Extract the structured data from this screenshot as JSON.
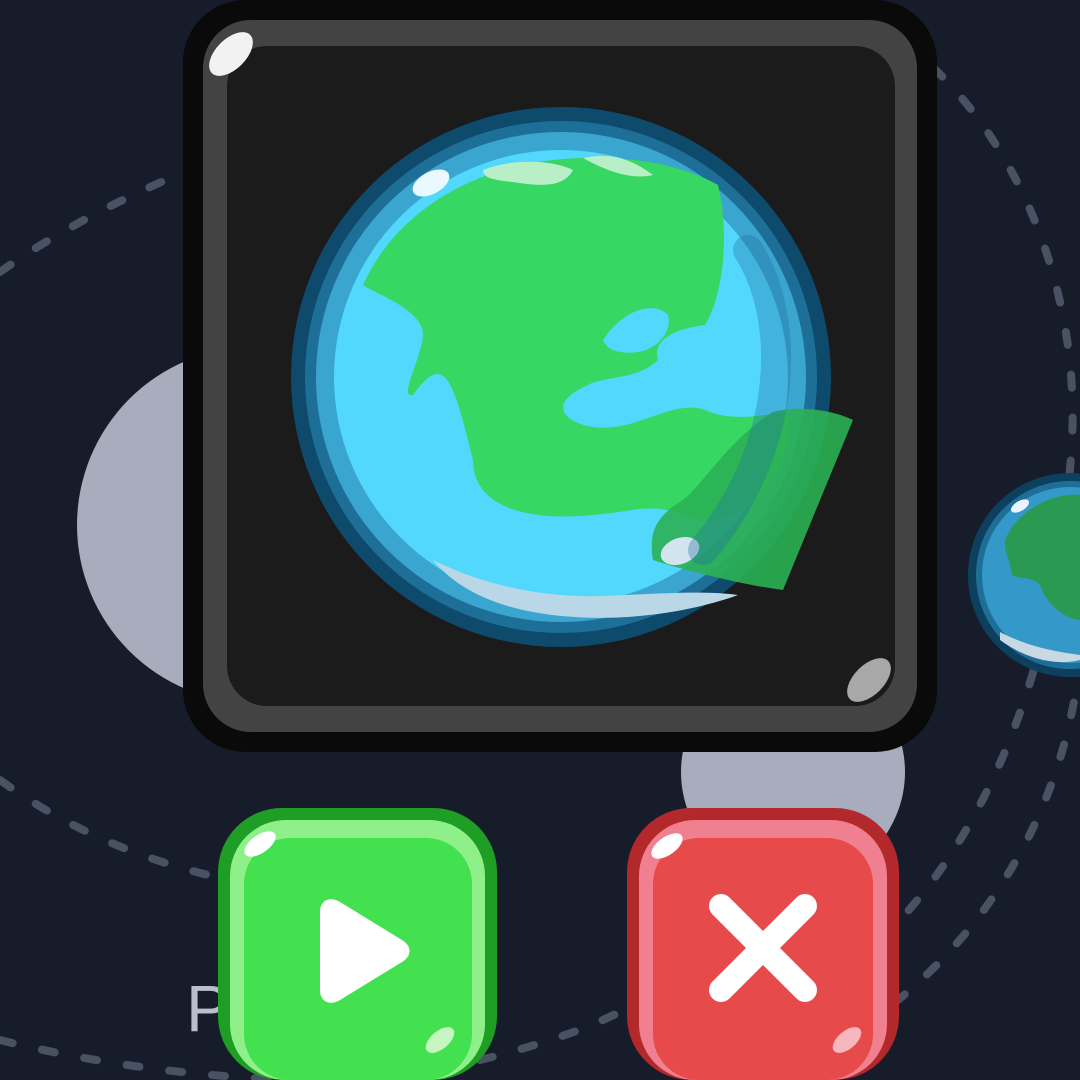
{
  "scene": {
    "background_color": "#171c2b",
    "orbit_color": "#4a5163",
    "moon_color": "#a7adbc",
    "partial_label": "P"
  },
  "selected_planet": {
    "icon": "earth-icon",
    "frame_color": "#1b1b1b",
    "ocean_color": "#52d8fc",
    "land_color": "#37d764"
  },
  "side_planet": {
    "icon": "earth-icon"
  },
  "buttons": {
    "play": {
      "icon": "play-icon",
      "color": "#43e04f"
    },
    "close": {
      "icon": "close-icon",
      "color": "#e64a4a"
    }
  }
}
